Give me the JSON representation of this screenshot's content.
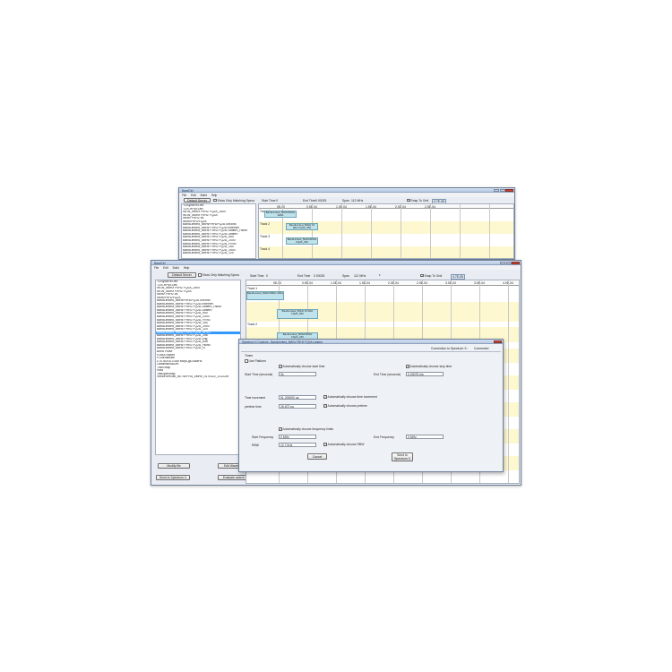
{
  "back_window": {
    "title": "BandCtrl",
    "menu": [
      "File",
      "Edit",
      "Build",
      "Help"
    ],
    "default_button": "Default Server",
    "show_only_label": "Show Only Matching Specs",
    "start_time_label": "Start Time",
    "start_time_value": "0",
    "end_time_label": "End Time",
    "end_time_value": "0.00025",
    "span_label": "Span",
    "span_value": "112 MHz",
    "snap_label": "Snap To Grid",
    "badge": "4.7E-05",
    "ticks": [
      "0E-00",
      "0.5E-04",
      "1.0E-04",
      "1.5E-04",
      "2.0E-04",
      "2.5E-04"
    ],
    "tracks": [
      "Track 1",
      "Track 2",
      "Track 3",
      "Track 4"
    ],
    "segments": [
      "BandLimited_5MHz/5MHz A00A",
      "BandLimited_5MHz 15 MHz FQ2A_550",
      "BandLimited_5MHz/5MHz FQ2A_150"
    ],
    "list": [
      "TDSyo5Rx:Dec",
      "TDS-RFyo:Dec",
      "WGN_5MHz FRH2 FQ2A_2500",
      "WGN_5MHz FRH2 FQ2A",
      "5MHz FRH2 5K",
      "5MHzFRH2FQ2A",
      "BandLimited_5MHzFRH2FQ2A Second",
      "BandLimited_5MHz FRH2 FQ2A Ethernet",
      "BandLimited_5MHz FRH2 FQ2A Lantern_HBrid",
      "BandLimited_5MHz FRH2 FQ2A Lantern",
      "BandLimited_5MHz FRH2 FQ2A_550",
      "BandLimited_5MHz FRH2 FQ2A_2000",
      "BandLimited_5MHz FRH2 FQ2A_FRH2",
      "BandLimited_5MHz FRH2 FQ2A_150",
      "BandLimited_5MHz FRH2 FQ2A_2500",
      "BandLimited_5MHz FRH2 FQ2A_120"
    ]
  },
  "main_window": {
    "title": "BandCtrl",
    "menu": [
      "File",
      "Edit",
      "Build",
      "Help"
    ],
    "default_button": "Default Server",
    "show_only_label": "Show Only Matching Specs",
    "start_time_label": "Start Time",
    "start_time_value": "0",
    "end_time_label": "End Time",
    "end_time_value": "0.00025",
    "span_label": "Span",
    "span_value": "112 MHz",
    "snap_label": "Snap To Grid",
    "badge": "4.7E-05",
    "ticks": [
      "0E-00",
      "0.5E-04",
      "1.0E-04",
      "1.5E-04",
      "2.0E-04",
      "2.5E-04",
      "3.0E-04",
      "3.5E-04",
      "4.0E-04",
      "4.5E-04"
    ],
    "tracks": [
      "Track 1",
      "Track 2",
      "Track 3"
    ],
    "segments": [
      "BandLimited_5MHz/5MHz A00A",
      "BandLimited_5MHz 15 MHz FQ2A_550",
      "BandLimited_5MHz/5MHz FQ2A_150"
    ],
    "list": [
      "TDSyo5Rx:Dec",
      "TDS-RFyo:Dec",
      "WGN_5MHz FRH2 FQ2A_2500",
      "WGN_5MHz FRH2 FQ2A",
      "5MHz FRH2 5K",
      "5MHzFRH2FQ2A",
      "BandLimited_5MHzFRH2FQ2A Second",
      "BandLimited_5MHz FRH2 FQ2A Ethernet",
      "BandLimited_5MHz FRH2 FQ2A Lantern_HBrid",
      "BandLimited_5MHz FRH2 FQ2A Lantern",
      "BandLimited_5MHz FRH2 FQ2A_550",
      "BandLimited_5MHz FRH2 FQ2A_2000",
      "BandLimited_5MHz FRH2 FQ2A_FRH2",
      "BandLimited_5MHz FRH2 FQ2A_150",
      "BandLimited_5MHz FRH2 FQ2A_2500",
      "BandLimited_5MHz FRH2 FQ2A_120",
      "BandLimited_5MHz FRH2 FQ2A_SPEC",
      "BandLimited_5MHz FRH2 FQ2A_256",
      "BandLimited_5MHz FRH2 FQ2A Orig",
      "BandLimited_5MHz FRH2 FQ2A_B30",
      "BandLimited_5MHz FRH2 FQ2A_HBrid",
      "BandLimited_5MHz FRH2 FQ2A_N",
      "Burst Pulse",
      "FDMA Sweet",
      "FCBEstimate",
      "LTE-5DSS-GSM Mix(s-gs-48MHz",
      "Landmarks&Dm",
      "Train Map",
      "Hold",
      "TestSpecmap",
      "VectorSeriTab_6E74EFRA_5MHz_0170322_1312ZM"
    ],
    "selected_index": 16,
    "modify_button": "Modify file",
    "edit_button": "Edit Waveform",
    "send_button": "Send to Spectrum X",
    "evaluate_button": "Evaluate search"
  },
  "dialog": {
    "title": "Spectrum X Controls - BandLimited_5MHz FRH2 FQ2A Lantern",
    "status_left": "Connection to Spectrum X:",
    "status_right": "Connected",
    "times_label": "Times",
    "use_platform_label": "Use Platform",
    "auto_start_label": "Automatically choose start time",
    "auto_stop_label": "Automatically choose stop time",
    "start_time_label": "Start Time (seconds)",
    "start_time_value": "0s",
    "end_time_label": "End Time (seconds)",
    "end_time_value": "0.00075 ms",
    "time_increment_label": "Time increment",
    "time_increment_value": "51.200000 µs",
    "auto_time_incr_label": "Automatically choose time increment",
    "pretime_label": "pretime time",
    "pretime_value": "26.672 µs",
    "auto_pretime_label": "Automatically choose pretime",
    "auto_freq_label": "Automatically choose frequency limits",
    "start_freq_label": "Start Frequency",
    "start_freq_value": "0 MHz",
    "end_freq_label": "End Frequency",
    "end_freq_value": "0 MHz",
    "rbw_label": "RBW",
    "rbw_value": "12.7 kHz",
    "auto_rbw_label": "Automatically choose RBW",
    "cancel_button": "Cancel",
    "send_button": "Send to Spectrum X"
  }
}
